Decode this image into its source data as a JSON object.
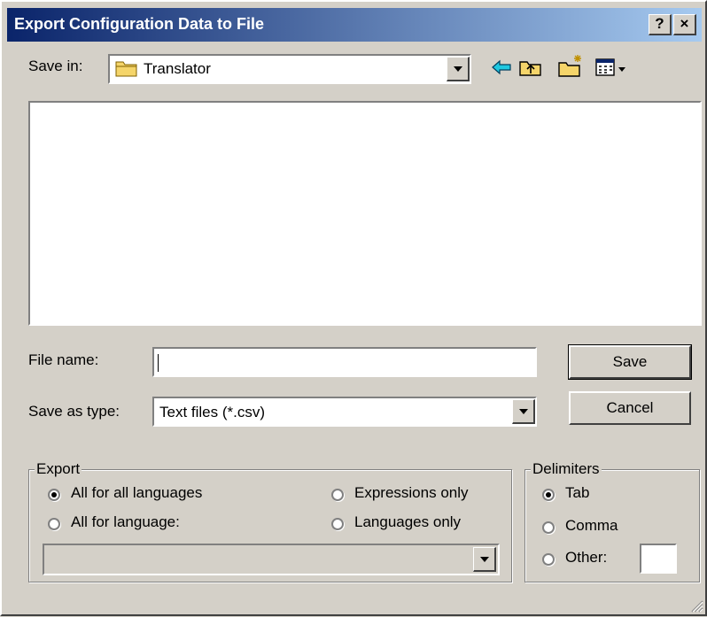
{
  "window": {
    "title": "Export Configuration Data to File",
    "help_label": "?",
    "close_label": "×"
  },
  "toolbar": {
    "save_in_label": "Save in:",
    "folder": "Translator",
    "icons": [
      "folder-icon",
      "back-arrow-icon",
      "up-folder-icon",
      "new-folder-icon",
      "view-menu-icon"
    ]
  },
  "filename": {
    "label": "File name:",
    "value": ""
  },
  "filetype": {
    "label": "Save as type:",
    "value": "Text files (*.csv)"
  },
  "buttons": {
    "save": "Save",
    "cancel": "Cancel"
  },
  "export": {
    "legend": "Export",
    "options": [
      "All for all languages",
      "All for language:",
      "Expressions only",
      "Languages only"
    ],
    "selected": "All for all languages",
    "language_value": ""
  },
  "delimiters": {
    "legend": "Delimiters",
    "options": [
      "Tab",
      "Comma",
      "Other:"
    ],
    "selected": "Tab",
    "other_value": ""
  },
  "colors": {
    "face": "#d4d0c8",
    "title_start": "#0a246a",
    "title_end": "#a6caf0"
  }
}
